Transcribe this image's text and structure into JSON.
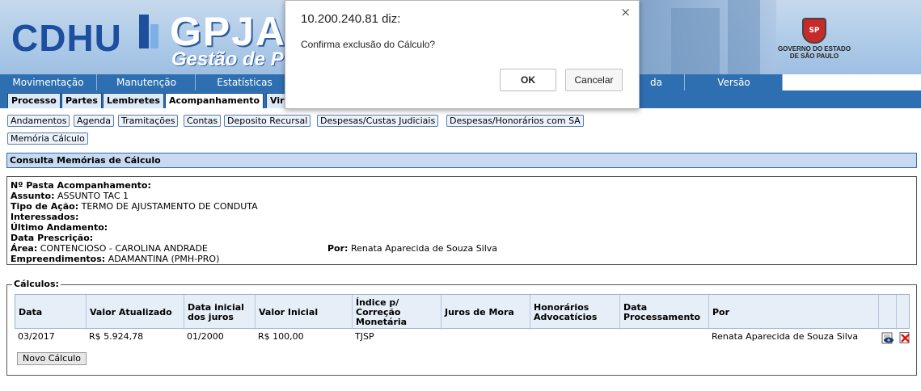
{
  "header": {
    "logo_cdhu": "CDHU",
    "logo_gpja": "GPJA",
    "logo_subtitle": "Gestão de P",
    "gov_line1": "GOVERNO DO ESTADO",
    "gov_line2": "DE SÃO PAULO",
    "seal_text": "SP"
  },
  "menu": {
    "items": [
      "Movimentação",
      "Manutenção",
      "Estatísticas",
      "da",
      "Versão"
    ]
  },
  "tabs": {
    "items": [
      "Processo",
      "Partes",
      "Lembretes",
      "Acompanhamento",
      "Vir"
    ],
    "active": "Acompanhamento"
  },
  "subtabs": {
    "items": [
      "Andamentos",
      "Agenda",
      "Tramitações",
      "Contas",
      "Deposito Recursal",
      "Despesas/Custas Judiciais",
      "Despesas/Honorários com SA",
      "Memória Cálculo"
    ]
  },
  "section": {
    "title": "Consulta Memórias de Cálculo"
  },
  "info": {
    "pasta_label": "Nº Pasta Acompanhamento:",
    "pasta_value": "",
    "assunto_label": "Assunto:",
    "assunto_value": "ASSUNTO TAC 1",
    "tipo_label": "Tipo de Ação:",
    "tipo_value": "TERMO DE AJUSTAMENTO DE CONDUTA",
    "interessados_label": "Interessados:",
    "ultimo_label": "Último Andamento:",
    "prescricao_label": "Data Prescrição:",
    "area_label": "Área:",
    "area_value": "CONTENCIOSO - CAROLINA ANDRADE",
    "por_label": "Por:",
    "por_value": "Renata Aparecida de Souza Silva",
    "empreend_label": "Empreendimentos:",
    "empreend_value": "ADAMANTINA (PMH-PRO)"
  },
  "calculos": {
    "legend": "Cálculos:",
    "headers": [
      "Data",
      "Valor Atualizado",
      "Data inicial dos juros",
      "Valor Inicial",
      "Índice p/ Correção Monetária",
      "Juros de Mora",
      "Honorários Advocatícios",
      "Data Processamento",
      "Por"
    ],
    "rows": [
      {
        "data": "03/2017",
        "valor_atualizado": "R$ 5.924,78",
        "data_inicial": "01/2000",
        "valor_inicial": "R$ 100,00",
        "indice": "TJSP",
        "juros": "",
        "honorarios": "",
        "processamento": "",
        "por": "Renata Aparecida de Souza Silva"
      }
    ],
    "novo_button": "Novo Cálculo",
    "icons": [
      "view-icon",
      "delete-icon"
    ]
  },
  "dialog": {
    "title": "10.200.240.81 diz:",
    "message": "Confirma exclusão do Cálculo?",
    "ok": "OK",
    "cancel": "Cancelar",
    "close": "×"
  }
}
